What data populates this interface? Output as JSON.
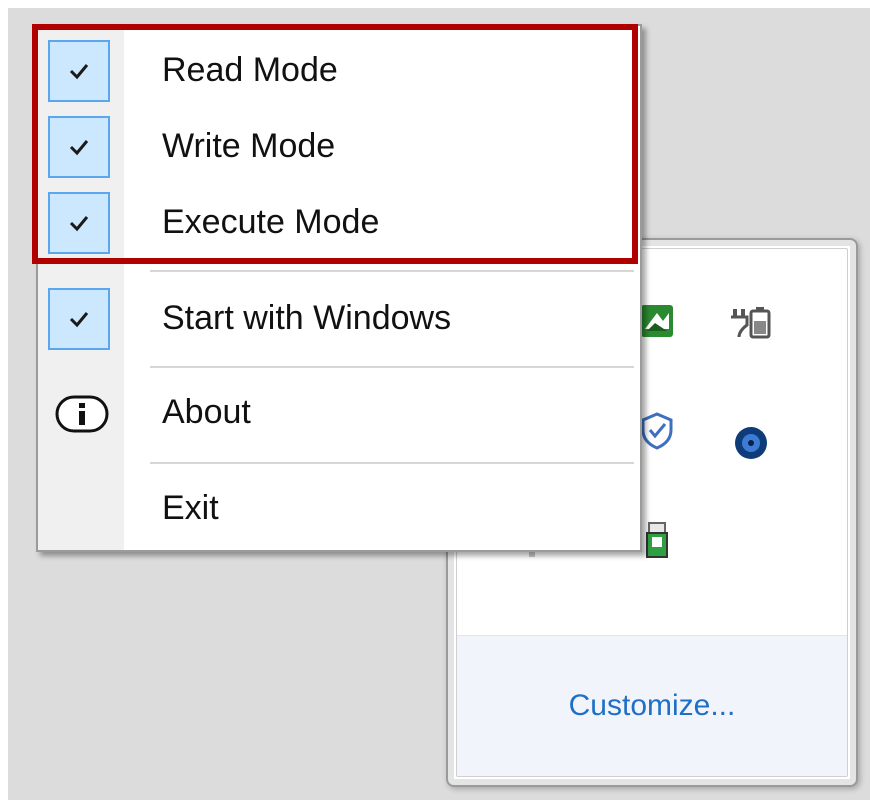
{
  "context_menu": {
    "items": [
      {
        "label": "Read Mode",
        "checked": true,
        "icon": "checkmark-icon"
      },
      {
        "label": "Write Mode",
        "checked": true,
        "icon": "checkmark-icon"
      },
      {
        "label": "Execute Mode",
        "checked": true,
        "icon": "checkmark-icon"
      },
      {
        "label": "Start with Windows",
        "checked": true,
        "icon": "checkmark-icon"
      },
      {
        "label": "About",
        "checked": false,
        "icon": "info-icon"
      },
      {
        "label": "Exit",
        "checked": false,
        "icon": ""
      }
    ]
  },
  "tray": {
    "customize_label": "Customize...",
    "icons": [
      "green-sync-icon",
      "battery-power-icon",
      "shield-icon",
      "blue-network-icon",
      "gray-network-icon",
      "usb-drive-icon"
    ]
  },
  "colors": {
    "highlight": "#b00000",
    "check_background": "#cce8ff",
    "check_border": "#5aa7f0",
    "link": "#1f6fc6"
  }
}
